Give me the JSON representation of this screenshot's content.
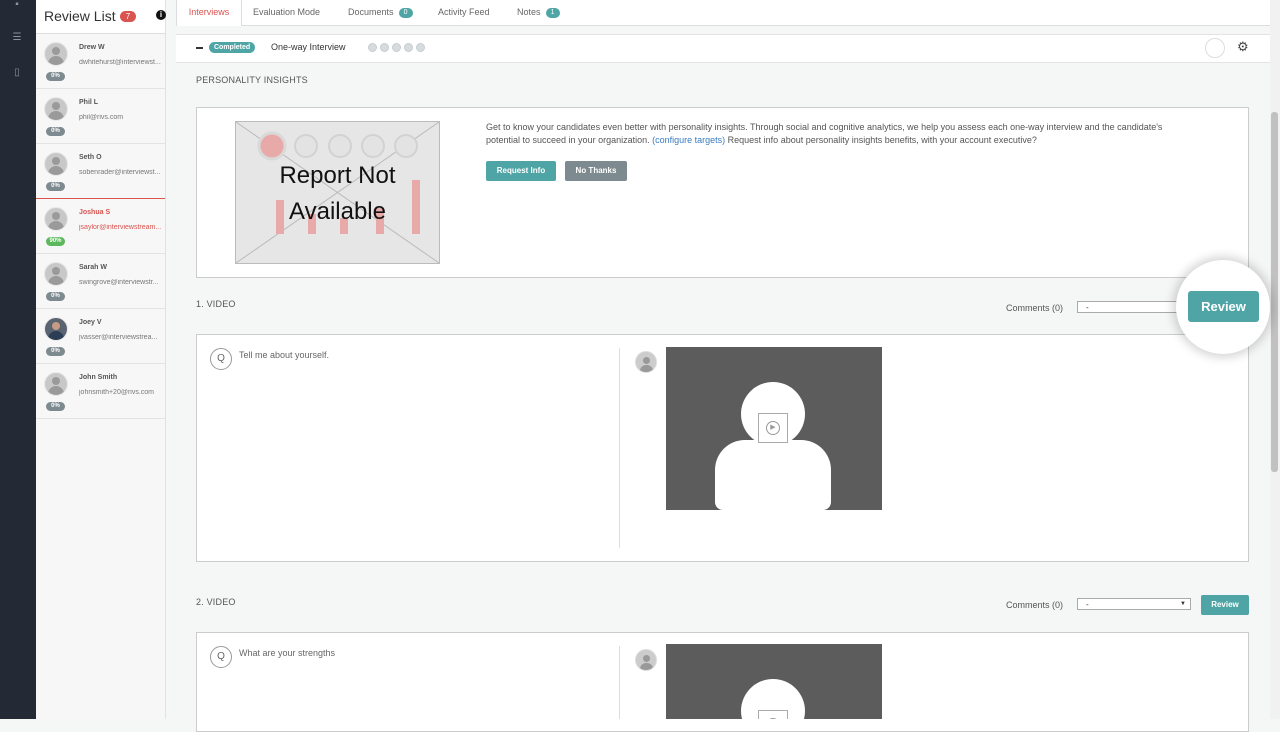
{
  "review_list": {
    "title": "Review List",
    "count": "7",
    "candidates": [
      {
        "name": "Drew W",
        "email": "dwhitehurst@interviewst...",
        "progress": "0%"
      },
      {
        "name": "Phil L",
        "email": "phil@rivs.com",
        "progress": "0%"
      },
      {
        "name": "Seth O",
        "email": "sobenrader@interviewst...",
        "progress": "0%"
      },
      {
        "name": "Joshua S",
        "email": "jsaylor@interviewstream...",
        "progress": "90%"
      },
      {
        "name": "Sarah W",
        "email": "swingrove@interviewstr...",
        "progress": "0%"
      },
      {
        "name": "Joey V",
        "email": "jvasser@interviewstrea...",
        "progress": "0%"
      },
      {
        "name": "John Smith",
        "email": "johnsmith+20@rivs.com",
        "progress": "0%"
      }
    ]
  },
  "tabs": [
    {
      "label": "Interviews"
    },
    {
      "label": "Evaluation Mode"
    },
    {
      "label": "Documents",
      "count": "0"
    },
    {
      "label": "Activity Feed"
    },
    {
      "label": "Notes",
      "count": "1"
    }
  ],
  "interview": {
    "status": "Completed",
    "type": "One-way Interview"
  },
  "personality": {
    "title": "PERSONALITY INSIGHTS",
    "report_text": "Report Not Available",
    "desc_1": "Get to know your candidates even better with personality insights. Through social and cognitive analytics, we help you assess each one-way interview and the candidate's potential to succeed in your organization. ",
    "desc_link": "(configure targets)",
    "desc_2": " Request info about personality insights benefits, with your account executive?",
    "request_label": "Request Info",
    "no_thanks_label": "No Thanks"
  },
  "questions": [
    {
      "title": "1. VIDEO",
      "comments": "Comments (0)",
      "select_value": "-",
      "review_label": "Review",
      "question": "Tell me about yourself."
    },
    {
      "title": "2. VIDEO",
      "comments": "Comments (0)",
      "select_value": "-",
      "review_label": "Review",
      "question": "What are your strengths"
    }
  ],
  "callout": {
    "label": "Review"
  },
  "colors": {
    "accent": "#4fa5a5",
    "alert": "#d9534f",
    "rail": "#232a35"
  }
}
